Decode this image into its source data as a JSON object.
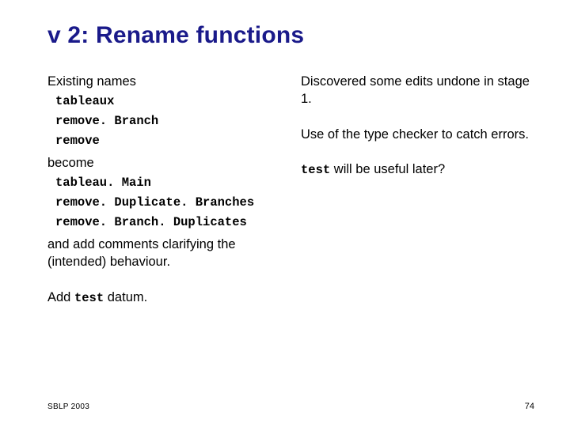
{
  "title": "v 2: Rename functions",
  "left": {
    "existing_heading": "Existing names",
    "existing": [
      "tableaux",
      "remove. Branch",
      "remove"
    ],
    "become_heading": "become",
    "become": [
      "tableau. Main",
      "remove. Duplicate. Branches",
      "remove. Branch. Duplicates"
    ],
    "comments": "and add comments clarifying the (intended) behaviour.",
    "add_prefix": "Add ",
    "add_code": "test",
    "add_suffix": " datum."
  },
  "right": {
    "p1": "Discovered some edits undone in stage 1.",
    "p2": "Use of the type checker to catch errors.",
    "p3_code": "test",
    "p3_rest": " will be useful later?"
  },
  "footer": {
    "left": "SBLP 2003",
    "right": "74"
  }
}
